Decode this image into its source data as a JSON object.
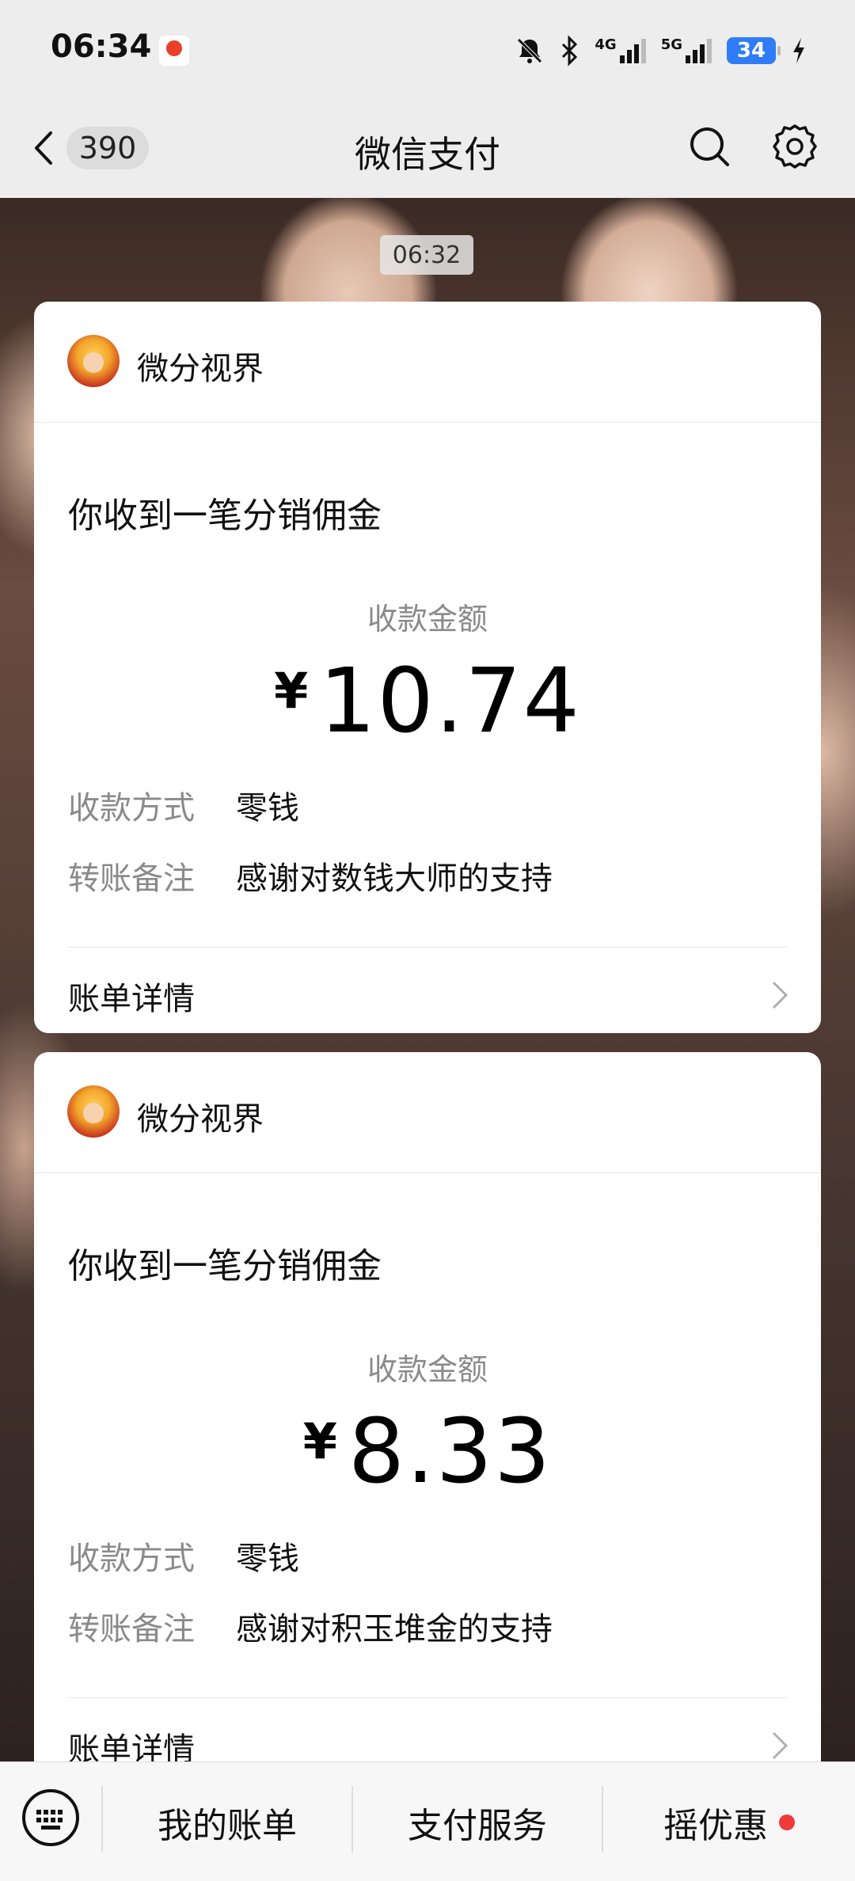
{
  "status_bar": {
    "time": "06:34",
    "network1": "4G",
    "network2": "5G",
    "battery": "34",
    "icons": [
      "mute-bell-icon",
      "bluetooth-icon",
      "signal-icon",
      "signal-icon",
      "battery-icon",
      "charging-icon"
    ]
  },
  "nav": {
    "unread_count": "390",
    "title": "微信支付",
    "icons": [
      "back-arrow-icon",
      "search-icon",
      "settings-gear-icon"
    ]
  },
  "timestamp": "06:32",
  "cards": [
    {
      "merchant": "微分视界",
      "title": "你收到一笔分销佣金",
      "amount_label": "收款金额",
      "currency": "¥",
      "amount": "10.74",
      "rows": [
        {
          "key": "收款方式",
          "value": "零钱"
        },
        {
          "key": "转账备注",
          "value": "感谢对数钱大师的支持"
        }
      ],
      "detail_label": "账单详情"
    },
    {
      "merchant": "微分视界",
      "title": "你收到一笔分销佣金",
      "amount_label": "收款金额",
      "currency": "¥",
      "amount": "8.33",
      "rows": [
        {
          "key": "收款方式",
          "value": "零钱"
        },
        {
          "key": "转账备注",
          "value": "感谢对积玉堆金的支持"
        }
      ],
      "detail_label": "账单详情"
    }
  ],
  "bottom_bar": {
    "items": [
      {
        "label": "我的账单"
      },
      {
        "label": "支付服务"
      },
      {
        "label": "摇优惠"
      }
    ]
  },
  "colors": {
    "background": "#ededed",
    "card": "#ffffff",
    "accent_red_dot": "#f03a3a",
    "battery": "#2f7cf6"
  }
}
